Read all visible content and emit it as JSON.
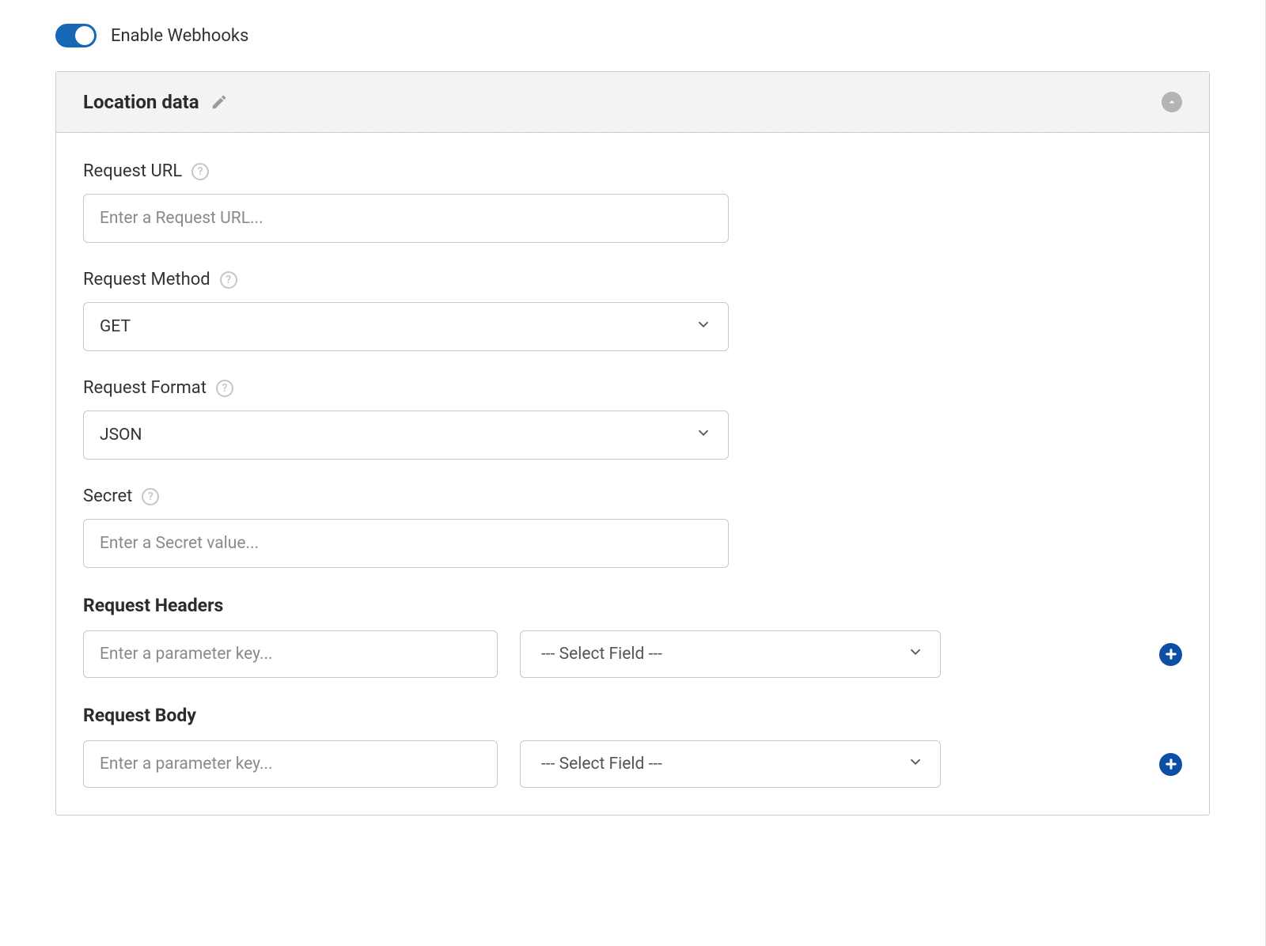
{
  "toggle": {
    "label": "Enable Webhooks",
    "on": true
  },
  "panel": {
    "title": "Location data"
  },
  "fields": {
    "requestUrl": {
      "label": "Request URL",
      "placeholder": "Enter a Request URL..."
    },
    "requestMethod": {
      "label": "Request Method",
      "value": "GET"
    },
    "requestFormat": {
      "label": "Request Format",
      "value": "JSON"
    },
    "secret": {
      "label": "Secret",
      "placeholder": "Enter a Secret value..."
    }
  },
  "sections": {
    "headers": {
      "heading": "Request Headers",
      "keyPlaceholder": "Enter a parameter key...",
      "selectPlaceholder": "--- Select Field ---"
    },
    "body": {
      "heading": "Request Body",
      "keyPlaceholder": "Enter a parameter key...",
      "selectPlaceholder": "--- Select Field ---"
    }
  }
}
